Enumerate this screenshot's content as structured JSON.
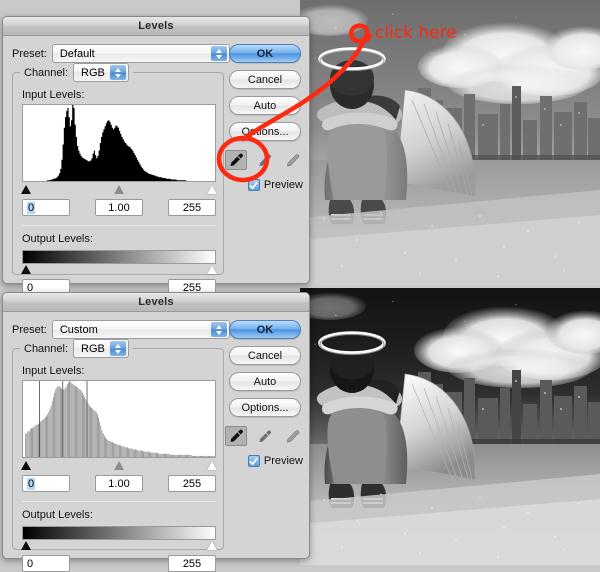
{
  "annotation": {
    "text": "click here",
    "color": "#fb2a11",
    "target": "black-point-eyedropper"
  },
  "dialogs": [
    {
      "id": "top",
      "title": "Levels",
      "preset": {
        "label": "Preset:",
        "value": "Default",
        "menu_icon": "preset-options-icon"
      },
      "channel": {
        "label": "Channel:",
        "value": "RGB"
      },
      "input_levels": {
        "label": "Input Levels:",
        "black": "0",
        "gamma": "1.00",
        "white": "255",
        "black_handle_pct": 2,
        "gamma_handle_pct": 50,
        "white_handle_pct": 98
      },
      "output_levels": {
        "label": "Output Levels:",
        "black": "0",
        "white": "255",
        "black_handle_pct": 2,
        "white_handle_pct": 98
      },
      "buttons": [
        "OK",
        "Cancel",
        "Auto",
        "Options..."
      ],
      "primary_button": "OK",
      "eyedroppers": [
        "black-point-eyedropper",
        "gray-point-eyedropper",
        "white-point-eyedropper"
      ],
      "active_eyedropper": 0,
      "preview": {
        "label": "Preview",
        "checked": true
      },
      "histogram": {
        "fill": "#000000",
        "style": "solid",
        "values": [
          0,
          0,
          0,
          0,
          0,
          0,
          0,
          0,
          0,
          0,
          0,
          0,
          0,
          0,
          0,
          0,
          0,
          0,
          0,
          0,
          1,
          1,
          1,
          2,
          2,
          3,
          3,
          4,
          5,
          7,
          10,
          16,
          28,
          48,
          70,
          84,
          92,
          96,
          84,
          72,
          80,
          100,
          96,
          74,
          58,
          46,
          40,
          36,
          33,
          31,
          30,
          29,
          28,
          27,
          26,
          26,
          27,
          30,
          36,
          40,
          34,
          30,
          33,
          40,
          50,
          58,
          64,
          68,
          72,
          76,
          79,
          80,
          78,
          74,
          70,
          68,
          70,
          73,
          72,
          70,
          66,
          62,
          58,
          55,
          52,
          50,
          48,
          46,
          45,
          44,
          42,
          40,
          37,
          34,
          31,
          28,
          25,
          22,
          19,
          17,
          15,
          13,
          12,
          11,
          10,
          9,
          9,
          8,
          8,
          7,
          7,
          6,
          6,
          5,
          5,
          5,
          4,
          4,
          4,
          3,
          3,
          3,
          3,
          2,
          2,
          2,
          2,
          2,
          1,
          1,
          1,
          1,
          1,
          1,
          1,
          1,
          0,
          0,
          0,
          0,
          0,
          0,
          0,
          0,
          0,
          0,
          0,
          0,
          0,
          0,
          0,
          0,
          0,
          0,
          0,
          0,
          0,
          0,
          0,
          0
        ]
      }
    },
    {
      "id": "bottom",
      "title": "Levels",
      "preset": {
        "label": "Preset:",
        "value": "Custom",
        "menu_icon": "preset-options-icon"
      },
      "channel": {
        "label": "Channel:",
        "value": "RGB"
      },
      "input_levels": {
        "label": "Input Levels:",
        "black": "0",
        "gamma": "1.00",
        "white": "255",
        "black_handle_pct": 2,
        "gamma_handle_pct": 50,
        "white_handle_pct": 98
      },
      "output_levels": {
        "label": "Output Levels:",
        "black": "0",
        "white": "255",
        "black_handle_pct": 2,
        "white_handle_pct": 98
      },
      "buttons": [
        "OK",
        "Cancel",
        "Auto",
        "Options..."
      ],
      "primary_button": "OK",
      "eyedroppers": [
        "black-point-eyedropper",
        "gray-point-eyedropper",
        "white-point-eyedropper"
      ],
      "active_eyedropper": 0,
      "preview": {
        "label": "Preview",
        "checked": true
      },
      "histogram": {
        "fill": "#7d7d7d",
        "style": "comb",
        "values": [
          0,
          0,
          22,
          22,
          24,
          24,
          26,
          27,
          27,
          28,
          29,
          30,
          30,
          31,
          32,
          33,
          34,
          35,
          36,
          37,
          38,
          40,
          42,
          45,
          48,
          52,
          56,
          60,
          63,
          65,
          66,
          66,
          65,
          64,
          63,
          63,
          64,
          66,
          68,
          70,
          71,
          70,
          69,
          68,
          67,
          66,
          66,
          65,
          64,
          63,
          62,
          60,
          58,
          56,
          54,
          52,
          50,
          48,
          47,
          46,
          45,
          44,
          43,
          42,
          40,
          37,
          33,
          29,
          25,
          22,
          20,
          18,
          17,
          16,
          15,
          15,
          14,
          14,
          13,
          13,
          12,
          12,
          11,
          11,
          11,
          10,
          10,
          10,
          9,
          9,
          9,
          8,
          8,
          8,
          8,
          7,
          7,
          7,
          7,
          6,
          6,
          6,
          6,
          6,
          5,
          5,
          5,
          5,
          5,
          5,
          4,
          4,
          4,
          4,
          4,
          4,
          4,
          3,
          3,
          3,
          3,
          3,
          3,
          3,
          3,
          3,
          3,
          2,
          2,
          2,
          2,
          2,
          2,
          2,
          2,
          2,
          2,
          2,
          2,
          2,
          2,
          2,
          2,
          2,
          2,
          2,
          1,
          1,
          1,
          1,
          1,
          1,
          1,
          1,
          1,
          1,
          1,
          1,
          1,
          1,
          1,
          1,
          1,
          1,
          1,
          1
        ]
      }
    }
  ],
  "photos": [
    {
      "id": "top",
      "alt": "grayscale angel figure with halo sitting before a city skyline, low contrast"
    },
    {
      "id": "bottom",
      "alt": "grayscale angel figure with halo sitting before a city skyline, high contrast dark sky"
    }
  ]
}
